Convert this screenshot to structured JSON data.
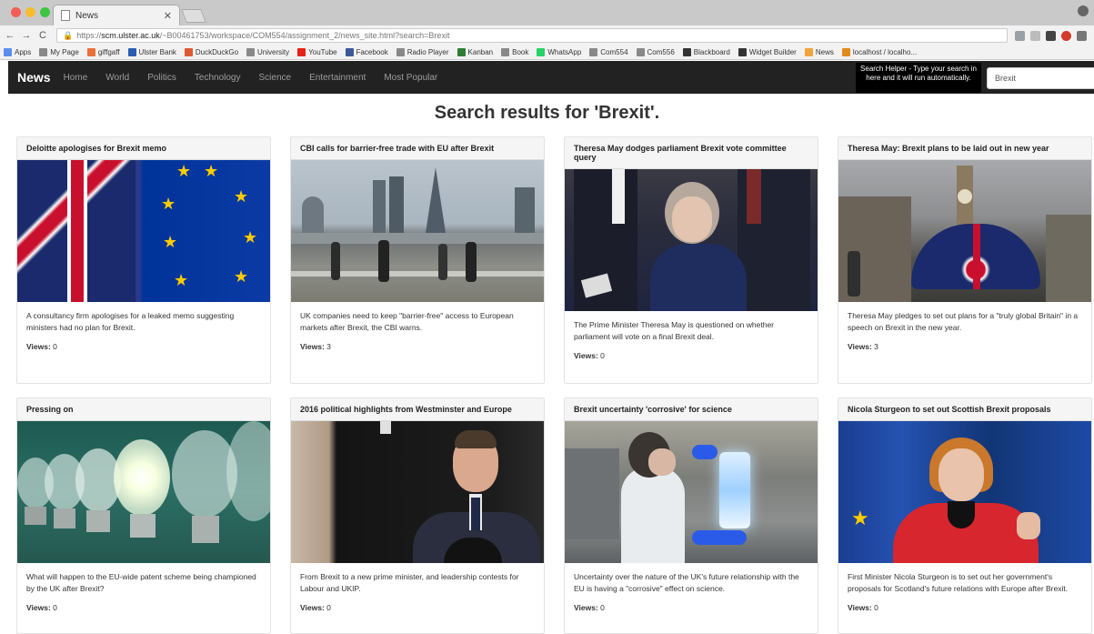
{
  "browser": {
    "tab_title": "News",
    "url_prefix": "https://",
    "url_host": "scm.ulster.ac.uk",
    "url_path": "/~B00461753/workspace/COM554/assignment_2/news_site.html?search=Brexit",
    "bookmarks": [
      {
        "label": "Apps",
        "color": "#5b8def"
      },
      {
        "label": "My Page",
        "color": "#888888"
      },
      {
        "label": "giffgaff",
        "color": "#e8703a"
      },
      {
        "label": "Ulster Bank",
        "color": "#2a5db0"
      },
      {
        "label": "DuckDuckGo",
        "color": "#de5833"
      },
      {
        "label": "University",
        "color": "#888888"
      },
      {
        "label": "YouTube",
        "color": "#e62117"
      },
      {
        "label": "Facebook",
        "color": "#3b5998"
      },
      {
        "label": "Radio Player",
        "color": "#888888"
      },
      {
        "label": "Kanban",
        "color": "#2e7d32"
      },
      {
        "label": "Book",
        "color": "#888888"
      },
      {
        "label": "WhatsApp",
        "color": "#25d366"
      },
      {
        "label": "Com554",
        "color": "#888888"
      },
      {
        "label": "Com556",
        "color": "#888888"
      },
      {
        "label": "Blackboard",
        "color": "#333333"
      },
      {
        "label": "Widget Builder",
        "color": "#333333"
      },
      {
        "label": "News",
        "color": "#f2a33a"
      },
      {
        "label": "localhost / localho...",
        "color": "#e08a1e"
      }
    ]
  },
  "navbar": {
    "brand": "News",
    "links": [
      "Home",
      "World",
      "Politics",
      "Technology",
      "Science",
      "Entertainment",
      "Most Popular"
    ],
    "helper_text": "Search Helper - Type your search in here and it will run automatically.",
    "search_value": "Brexit"
  },
  "page_title": "Search results for 'Brexit'.",
  "views_label": "Views:",
  "cards": [
    {
      "title": "Deloitte apologises for Brexit memo",
      "summary": "A consultancy firm apologises for a leaked memo suggesting ministers had no plan for Brexit.",
      "views": "0"
    },
    {
      "title": "CBI calls for barrier-free trade with EU after Brexit",
      "summary": "UK companies need to keep \"barrier-free\" access to European markets after Brexit, the CBI warns.",
      "views": "3"
    },
    {
      "title": "Theresa May dodges parliament Brexit vote committee query",
      "summary": "The Prime Minister Theresa May is questioned on whether parliament will vote on a final Brexit deal.",
      "views": "0"
    },
    {
      "title": "Theresa May: Brexit plans to be laid out in new year",
      "summary": "Theresa May pledges to set out plans for a \"truly global Britain\" in a speech on Brexit in the new year.",
      "views": "3"
    },
    {
      "title": "Pressing on",
      "summary": "What will happen to the EU-wide patent scheme being championed by the UK after Brexit?",
      "views": "0"
    },
    {
      "title": "2016 political highlights from Westminster and Europe",
      "summary": "From Brexit to a new prime minister, and leadership contests for Labour and UKIP.",
      "views": "0"
    },
    {
      "title": "Brexit uncertainty 'corrosive' for science",
      "summary": "Uncertainty over the nature of the UK's future relationship with the EU is having a \"corrosive\" effect on science.",
      "views": "0"
    },
    {
      "title": "Nicola Sturgeon to set out Scottish Brexit proposals",
      "summary": "First Minister Nicola Sturgeon is to set out her government's proposals for Scotland's future relations with Europe after Brexit.",
      "views": "0"
    }
  ]
}
